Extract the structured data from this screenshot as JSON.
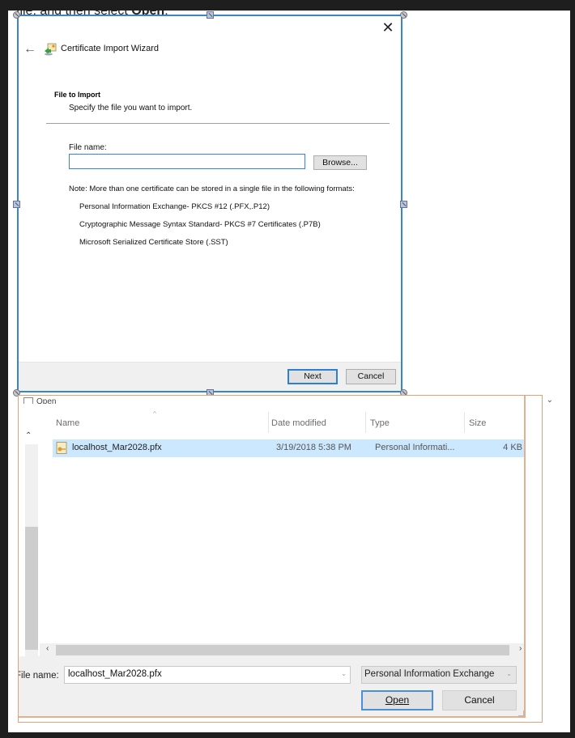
{
  "doc": {
    "instruction_prefix": "file, and then select ",
    "instruction_bold": "Open",
    "instruction_suffix": "."
  },
  "wizard": {
    "title": "Certificate Import Wizard",
    "back_icon": "arrow-left",
    "close_icon": "close-x",
    "heading": "File to Import",
    "subheading": "Specify the file you want to import.",
    "file_name_label": "File name:",
    "file_name_value": "",
    "browse_label": "Browse...",
    "note": "Note:  More than one certificate can be stored in a single file in the following formats:",
    "formats": [
      "Personal Information Exchange- PKCS #12 (.PFX,.P12)",
      "Cryptographic Message Syntax Standard- PKCS #7 Certificates (.P7B)",
      "Microsoft Serialized Certificate Store (.SST)"
    ],
    "next_label": "Next",
    "cancel_label": "Cancel"
  },
  "open_dialog": {
    "title": "Open",
    "columns": [
      "Name",
      "Date modified",
      "Type",
      "Size"
    ],
    "files": [
      {
        "name": "localhost_Mar2028.pfx",
        "date_modified": "3/19/2018 5:38 PM",
        "type": "Personal Informati...",
        "size": "4 KB",
        "selected": true
      }
    ],
    "file_name_label": "File name:",
    "file_name_value": "localhost_Mar2028.pfx",
    "filter_value": "Personal Information Exchange",
    "open_label": "Open",
    "cancel_label": "Cancel"
  },
  "colors": {
    "selection_accent": "#cce8ff",
    "wizard_border": "#3a84c8",
    "dialog_border": "#d9a47a"
  }
}
